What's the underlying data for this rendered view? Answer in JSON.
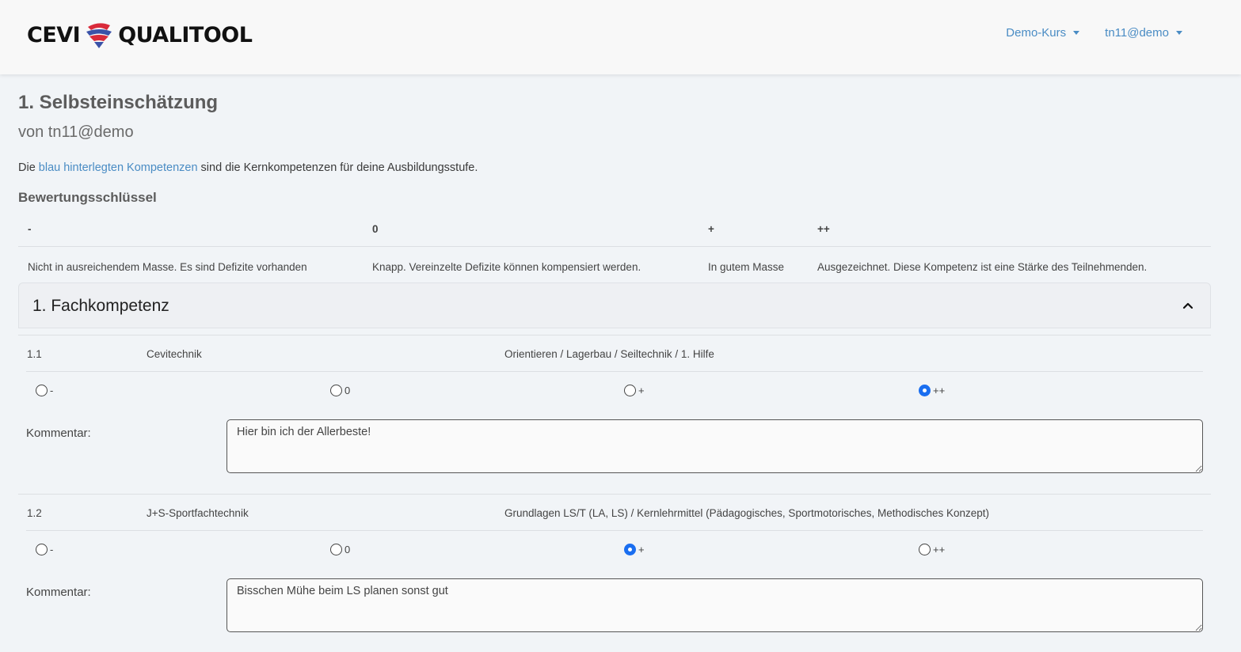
{
  "app": {
    "brand_left": "CEVI",
    "brand_right": "QUALITOOL",
    "course_menu": "Demo-Kurs",
    "user_menu": "tn11@demo"
  },
  "page": {
    "title": "1. Selbsteinschätzung",
    "subtitle": "von tn11@demo",
    "intro_prefix": "Die ",
    "intro_link": "blau hinterlegten Kompetenzen",
    "intro_suffix": " sind die Kernkompetenzen für deine Ausbildungsstufe."
  },
  "rating_key": {
    "title": "Bewertungsschlüssel",
    "headers": [
      "-",
      "0",
      "+",
      "++"
    ],
    "descriptions": [
      "Nicht in ausreichendem Masse. Es sind Defizite vorhanden",
      "Knapp. Vereinzelte Defizite können kompensiert werden.",
      "In gutem Masse",
      "Ausgezeichnet. Diese Kompetenz ist eine Stärke des Teilnehmenden."
    ]
  },
  "section": {
    "title": "1. Fachkompetenz",
    "competences": [
      {
        "number": "1.1",
        "name": "Cevitechnik",
        "description": "Orientieren / Lagerbau / Seiltechnik / 1. Hilfe",
        "options": [
          "-",
          "0",
          "+",
          "++"
        ],
        "selected": "++",
        "comment_label": "Kommentar:",
        "comment": "Hier bin ich der Allerbeste!"
      },
      {
        "number": "1.2",
        "name": "J+S-Sportfachtechnik",
        "description": "Grundlagen LS/T (LA, LS) / Kernlehrmittel (Pädagogisches, Sportmotorisches, Methodisches Konzept)",
        "options": [
          "-",
          "0",
          "+",
          "++"
        ],
        "selected": "+",
        "comment_label": "Kommentar:",
        "comment": "Bisschen Mühe beim LS planen sonst gut"
      }
    ]
  },
  "colors": {
    "accent": "#4a8cc4",
    "radio_checked": "#1a6ef0",
    "logo_red": "#d92a3a",
    "logo_blue": "#3a52a8"
  }
}
